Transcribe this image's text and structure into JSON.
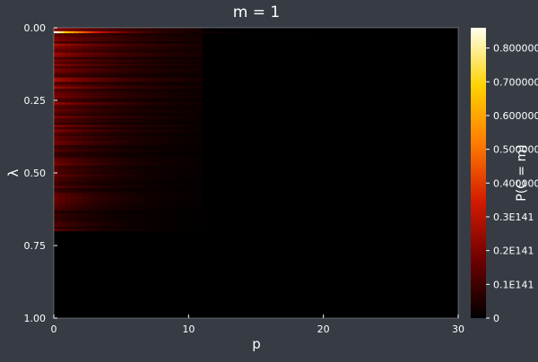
{
  "chart_data": {
    "type": "heatmap",
    "title": "m = 1",
    "xlabel": "p",
    "ylabel": "λ",
    "xlim": [
      0,
      30
    ],
    "ylim": [
      1.0,
      0.0
    ],
    "x_ticks": [
      {
        "value": 0,
        "label": "0"
      },
      {
        "value": 10,
        "label": "10"
      },
      {
        "value": 20,
        "label": "20"
      },
      {
        "value": 30,
        "label": "30"
      }
    ],
    "y_ticks": [
      {
        "value": 0.0,
        "label": "0.00"
      },
      {
        "value": 0.25,
        "label": "0.25"
      },
      {
        "value": 0.5,
        "label": "0.50"
      },
      {
        "value": 0.75,
        "label": "0.75"
      },
      {
        "value": 1.0,
        "label": "1.00"
      }
    ],
    "colorbar": {
      "label": "P(C = m)",
      "colormap": [
        "#000000",
        "#6e0000",
        "#d21a00",
        "#ff7a00",
        "#ffd200",
        "#fffff0"
      ],
      "ticks": [
        {
          "value": 0,
          "label": "0"
        },
        {
          "value": 0.1,
          "label": "0.1E141"
        },
        {
          "value": 0.2,
          "label": "0.2E141"
        },
        {
          "value": 0.3,
          "label": "0.3E141"
        },
        {
          "value": 0.4,
          "label": "0.400000"
        },
        {
          "value": 0.5,
          "label": "0.500000"
        },
        {
          "value": 0.6,
          "label": "0.600000"
        },
        {
          "value": 0.7,
          "label": "0.700000"
        },
        {
          "value": 0.8,
          "label": "0.800000"
        }
      ],
      "range": [
        0,
        0.86
      ]
    },
    "regions": [
      {
        "lambda_range": [
          0.0,
          0.01
        ],
        "p_range": [
          0,
          22
        ],
        "peak_value": 0.86
      },
      {
        "lambda_range": [
          0.0,
          0.7
        ],
        "p_range": [
          0,
          6
        ],
        "peak_value": 0.3
      },
      {
        "lambda_range": [
          0.7,
          1.0
        ],
        "p_range": [
          0,
          30
        ],
        "peak_value": 0
      }
    ]
  }
}
